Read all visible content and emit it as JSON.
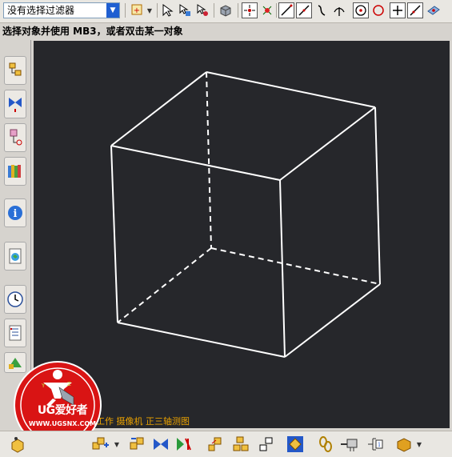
{
  "app": {
    "filter": {
      "selected": "没有选择过滤器"
    }
  },
  "status": {
    "prompt": "选择对象并使用 MB3，或者双击某一对象"
  },
  "viewport": {
    "background": "#26272b",
    "model_line_color": "#ffffff",
    "view_label": "工作 摄像机 正三轴测图"
  },
  "watermark": {
    "brand": "UG爱好者",
    "url": "WWW.UGSNX.COM"
  },
  "toolbars": {
    "top": [
      "type-filter-icon",
      "select-cursor-icon",
      "select-feature-icon",
      "select-body-icon",
      "cube-icon",
      "snap-point-icon",
      "snap-arc-center-icon",
      "snap-endpoint-icon",
      "snap-midpoint-icon",
      "snap-control-point-icon",
      "snap-intersection-icon",
      "snap-arc-center-circle-icon",
      "snap-quadrant-icon",
      "snap-existing-point-icon",
      "snap-point-on-curve-icon",
      "snap-point-on-surface-icon"
    ],
    "left": [
      "assembly-navigator-icon",
      "constraint-navigator-icon",
      "part-navigator-icon",
      "reuse-library-icon",
      "info-icon",
      "web-browser-icon",
      "history-icon",
      "system-materials-icon",
      "roles-icon"
    ],
    "bottom": [
      "assembly-icon",
      "add-component-icon",
      "mirror-assembly-icon",
      "constraints-icon",
      "move-component-icon",
      "explode-icon",
      "sequence-icon",
      "wave-icon",
      "interference-icon",
      "arrangement-icon",
      "product-interface-icon",
      "view-options-icon"
    ]
  }
}
